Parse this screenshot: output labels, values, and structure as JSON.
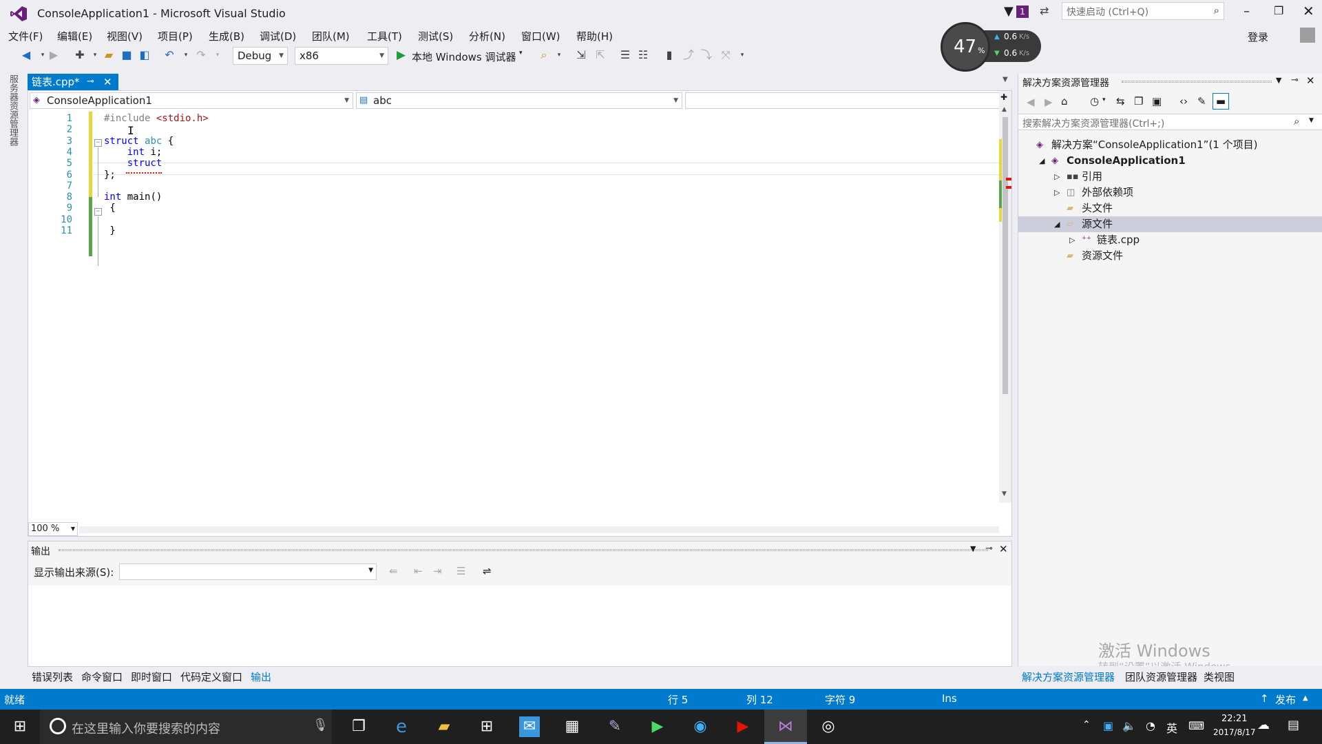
{
  "window": {
    "title": "ConsoleApplication1 - Microsoft Visual Studio",
    "notification_count": "1",
    "quick_launch_placeholder": "快速启动 (Ctrl+Q)",
    "login_label": "登录"
  },
  "menu": [
    "文件(F)",
    "编辑(E)",
    "视图(V)",
    "项目(P)",
    "生成(B)",
    "调试(D)",
    "团队(M)",
    "工具(T)",
    "测试(S)",
    "分析(N)",
    "窗口(W)",
    "帮助(H)"
  ],
  "toolbar": {
    "config": "Debug",
    "platform": "x86",
    "run_label": "本地 Windows 调试器"
  },
  "perf": {
    "percent": "47",
    "percent_unit": "%",
    "up": "0.6",
    "down": "0.6",
    "unit": "K/s"
  },
  "side_strip": {
    "label": "服务器资源管理器"
  },
  "editor": {
    "tab_label": "链表.cpp*",
    "project_combo": "ConsoleApplication1",
    "scope_combo": "abc",
    "zoom": "100 %",
    "lines": [
      {
        "n": "1",
        "parts": [
          {
            "t": "#include ",
            "c": "pp"
          },
          {
            "t": "<stdio.h>",
            "c": "inc"
          }
        ]
      },
      {
        "n": "2",
        "parts": []
      },
      {
        "n": "3",
        "parts": [
          {
            "t": "struct ",
            "c": "kw"
          },
          {
            "t": "abc",
            "c": "ty"
          },
          {
            "t": " {",
            "c": ""
          }
        ]
      },
      {
        "n": "4",
        "parts": [
          {
            "t": "    ",
            "c": ""
          },
          {
            "t": "int",
            "c": "kw"
          },
          {
            "t": " i;",
            "c": ""
          }
        ]
      },
      {
        "n": "5",
        "parts": [
          {
            "t": "    ",
            "c": ""
          },
          {
            "t": "struct",
            "c": "kw"
          }
        ]
      },
      {
        "n": "6",
        "parts": [
          {
            "t": "};",
            "c": ""
          }
        ]
      },
      {
        "n": "7",
        "parts": []
      },
      {
        "n": "8",
        "parts": [
          {
            "t": "int",
            "c": "kw"
          },
          {
            "t": " main()",
            "c": ""
          }
        ]
      },
      {
        "n": "9",
        "parts": [
          {
            "t": " {",
            "c": ""
          }
        ]
      },
      {
        "n": "10",
        "parts": []
      },
      {
        "n": "11",
        "parts": [
          {
            "t": " }",
            "c": ""
          }
        ]
      }
    ]
  },
  "output": {
    "title": "输出",
    "source_label": "显示输出来源(S):",
    "source_value": ""
  },
  "bottom_tabs": [
    "错误列表",
    "命令窗口",
    "即时窗口",
    "代码定义窗口",
    "输出"
  ],
  "solution": {
    "title": "解决方案资源管理器",
    "search_placeholder": "搜索解决方案资源管理器(Ctrl+;)",
    "tree": [
      {
        "label": "解决方案“ConsoleApplication1”(1 个项目)",
        "indent": 0,
        "expander": "",
        "icon": "solution-icon",
        "bold": false
      },
      {
        "label": "ConsoleApplication1",
        "indent": 1,
        "expander": "◢",
        "icon": "project-icon",
        "bold": true
      },
      {
        "label": "引用",
        "indent": 2,
        "expander": "▷",
        "icon": "references-icon",
        "bold": false
      },
      {
        "label": "外部依赖项",
        "indent": 2,
        "expander": "▷",
        "icon": "external-deps-icon",
        "bold": false
      },
      {
        "label": "头文件",
        "indent": 2,
        "expander": "",
        "icon": "folder-icon",
        "bold": false
      },
      {
        "label": "源文件",
        "indent": 2,
        "expander": "◢",
        "icon": "folder-open-icon",
        "bold": false,
        "selected": true
      },
      {
        "label": "链表.cpp",
        "indent": 3,
        "expander": "▷",
        "icon": "cpp-file-icon",
        "bold": false
      },
      {
        "label": "资源文件",
        "indent": 2,
        "expander": "",
        "icon": "folder-icon",
        "bold": false
      }
    ],
    "tabs": [
      "解决方案资源管理器",
      "团队资源管理器",
      "类视图"
    ]
  },
  "watermark": {
    "line1": "激活 Windows",
    "line2": "转到“设置”以激活 Windows。"
  },
  "status": {
    "ready": "就绪",
    "row": "行 5",
    "col": "列 12",
    "char": "字符 9",
    "ins": "Ins",
    "publish": "发布"
  },
  "taskbar": {
    "search_placeholder": "在这里输入你要搜索的内容",
    "ime": "英",
    "time": "22:21",
    "date": "2017/8/17"
  },
  "colors": {
    "accent": "#007acc",
    "chrome": "#eeeef2",
    "vs_purple": "#68217a",
    "taskbar": "#1f1f1f"
  }
}
